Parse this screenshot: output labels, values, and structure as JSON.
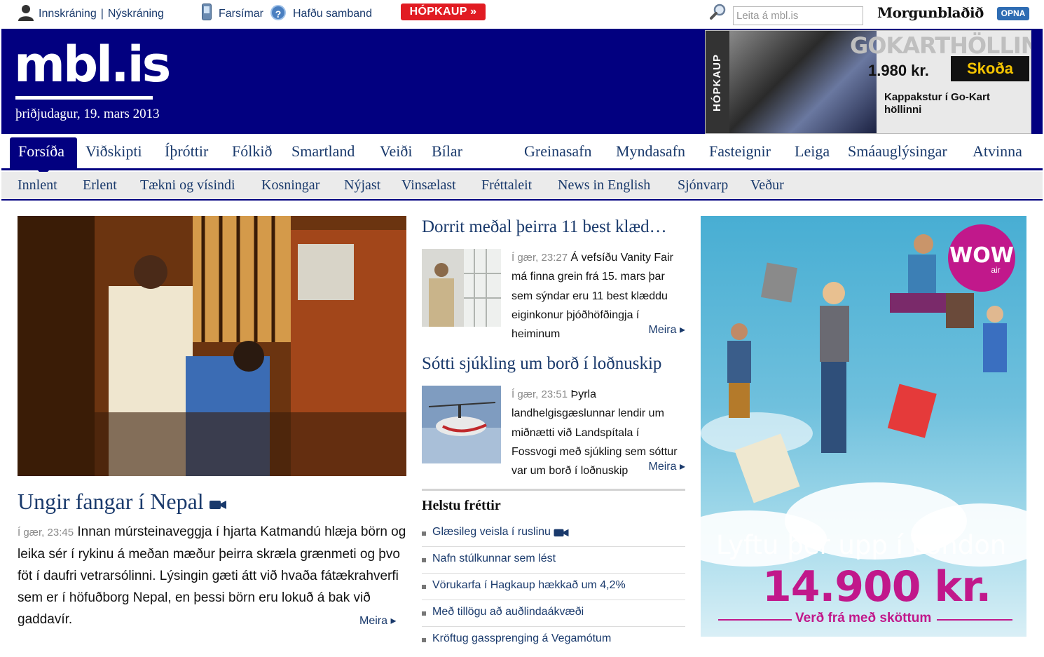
{
  "topbar": {
    "login": "Innskráning",
    "signup": "Nýskráning",
    "mobile": "Farsímar",
    "contact": "Hafðu samband",
    "hopkaup": "HÓPKAUP »",
    "search_placeholder": "Leita á mbl.is",
    "paper_logo": "Morgunblaðið",
    "opna": "OPNA"
  },
  "header": {
    "logo": "mbl.is",
    "date": "þriðjudagur, 19. mars 2013",
    "ad": {
      "side": "HÓPKAUP",
      "title": "GOKARTHÖLLIN",
      "price": "1.980 kr.",
      "cta": "Skoða",
      "desc1": "Kappakstur í Go-Kart",
      "desc2": "höllinni"
    }
  },
  "mainnav": {
    "active": "Forsíða",
    "items": [
      "Viðskipti",
      "Íþróttir",
      "Fólkið",
      "Smartland",
      "Veiði",
      "Bílar",
      "Greinasafn",
      "Myndasafn",
      "Fasteignir",
      "Leiga",
      "Smáauglýsingar",
      "Atvinna"
    ]
  },
  "subnav": {
    "items": [
      "Innlent",
      "Erlent",
      "Tækni og vísindi",
      "Kosningar",
      "Nýjast",
      "Vinsælast",
      "Fréttaleit",
      "News in English",
      "Sjónvarp",
      "Veður"
    ]
  },
  "lead": {
    "headline": "Ungir fangar í Nepal",
    "time": "Í gær, 23:45",
    "body": "Innan múrsteinaveggja í hjarta Katmandú hlæja börn og leika sér í rykinu á meðan mæður þeirra skræla grænmeti og þvo föt í daufri vetrarsólinni. Lýsingin gæti átt við hvaða fátækrahverfi sem er í höfuðborg Nepal, en þessi börn eru lokuð á bak við gaddavír.",
    "more": "Meira"
  },
  "stories": [
    {
      "title": "Dorrit meðal þeirra 11 best klæd…",
      "time": "Í gær, 23:27",
      "body": "Á vefsíðu Vanity Fair má finna grein frá 15. mars þar sem sýndar eru 11 best klæddu eiginkonur þjóðhöfðingja í heiminum",
      "more": "Meira"
    },
    {
      "title": "Sótti sjúkling um borð í loðnuskip",
      "time": "Í gær, 23:51",
      "body": "Þyrla landhelgisgæslunnar lendir um miðnætti við Landspítala í Fossvogi með sjúkling sem sóttur var um borð í loðnuskip",
      "more": "Meira"
    }
  ],
  "helstu": {
    "title": "Helstu fréttir",
    "items": [
      "Glæsileg veisla í ruslinu",
      "Nafn stúlkunnar sem lést",
      "Vörukarfa í Hagkaup hækkað um 4,2%",
      "Með tillögu að auðlindaákvæði",
      "Kröftug gassprenging á Vegamótum"
    ]
  },
  "wow_ad": {
    "logo": "WOW",
    "logo_sub": "air",
    "tagline": "Lyftu þér upp í London",
    "price": "14.900 kr.",
    "sub": "Verð frá með sköttum"
  },
  "colors": {
    "brand_blue": "#020080",
    "link": "#1a3a6c",
    "wow_pink": "#c1188b",
    "hopkaup_red": "#e11b22"
  }
}
